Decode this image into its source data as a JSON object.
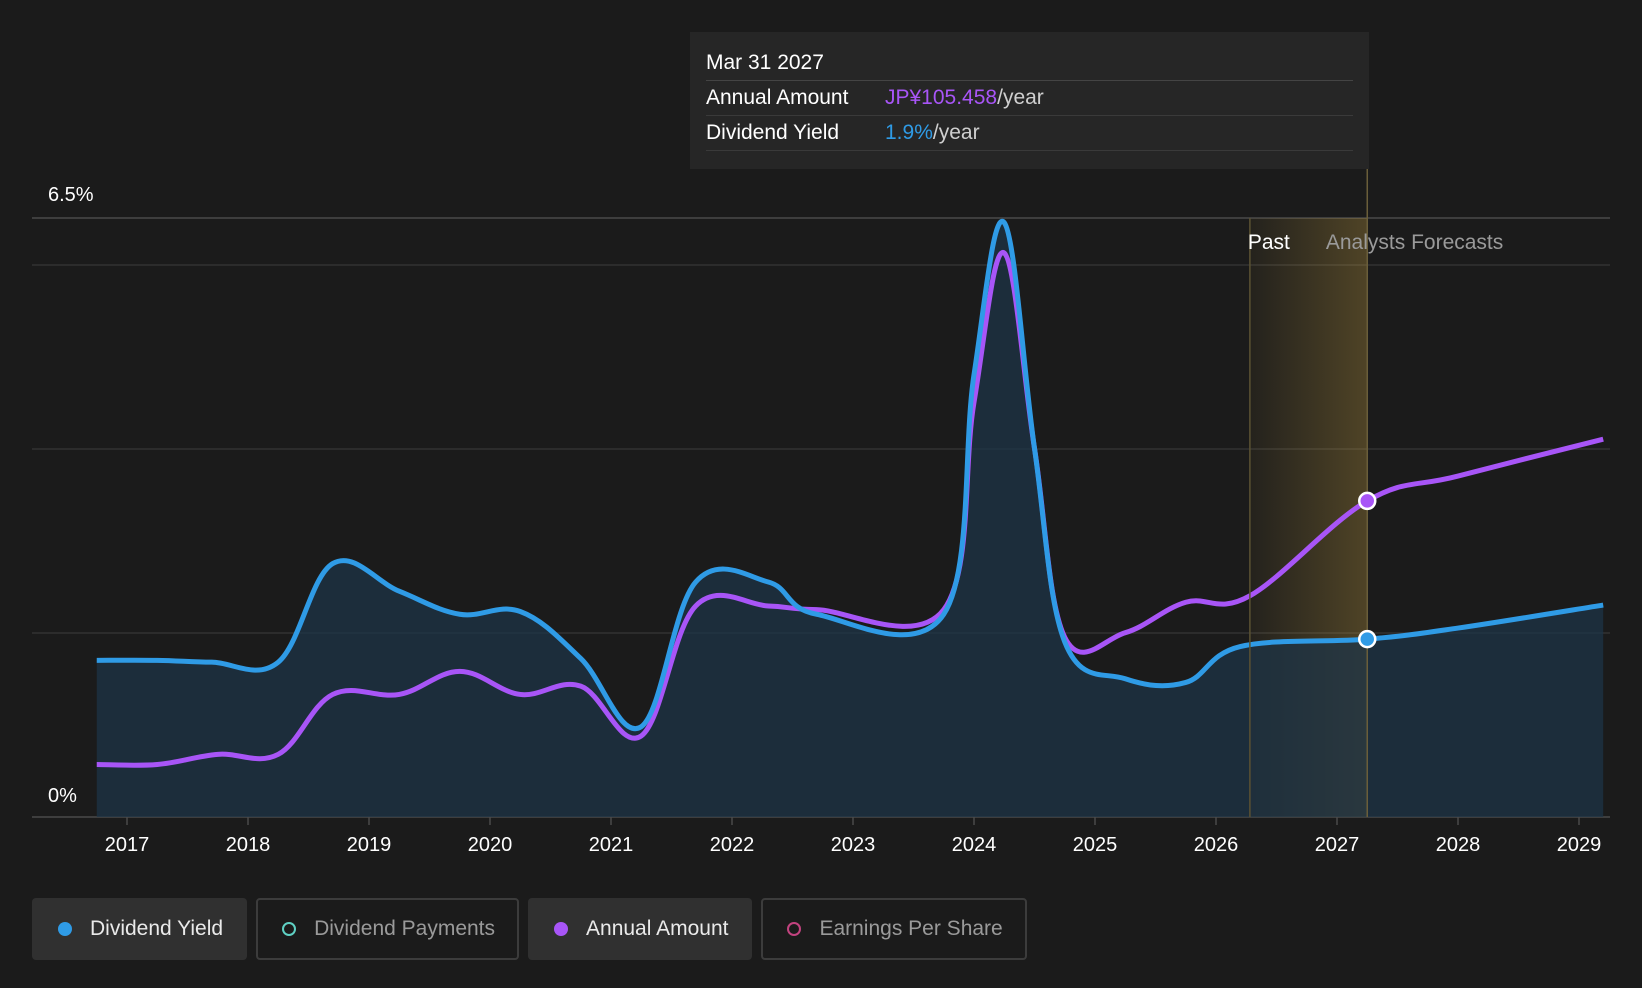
{
  "chart_data": {
    "type": "area",
    "y_axis": {
      "labels": [
        "6.5%",
        "0%"
      ],
      "ylim": [
        0,
        6.5
      ],
      "unit": "%"
    },
    "x_axis": {
      "ticks": [
        "2017",
        "2018",
        "2019",
        "2020",
        "2021",
        "2022",
        "2023",
        "2024",
        "2025",
        "2026",
        "2027",
        "2028",
        "2029"
      ],
      "range": [
        2016.75,
        2029.2
      ]
    },
    "regions": {
      "past_label": "Past",
      "forecast_label": "Analysts Forecasts",
      "divider_x": 2026.28
    },
    "series": [
      {
        "name": "Dividend Yield",
        "color": "#2f9be6",
        "points": [
          [
            2016.75,
            1.7
          ],
          [
            2017.25,
            1.7
          ],
          [
            2017.7,
            1.68
          ],
          [
            2018.25,
            1.68
          ],
          [
            2018.7,
            2.75
          ],
          [
            2019.25,
            2.45
          ],
          [
            2019.75,
            2.2
          ],
          [
            2020.25,
            2.23
          ],
          [
            2020.75,
            1.72
          ],
          [
            2021.25,
            0.98
          ],
          [
            2021.7,
            2.55
          ],
          [
            2022.3,
            2.55
          ],
          [
            2022.7,
            2.2
          ],
          [
            2023.75,
            2.2
          ],
          [
            2024.0,
            4.8
          ],
          [
            2024.25,
            6.45
          ],
          [
            2024.5,
            4.0
          ],
          [
            2024.75,
            1.9
          ],
          [
            2025.25,
            1.5
          ],
          [
            2025.75,
            1.46
          ],
          [
            2026.2,
            1.85
          ],
          [
            2027.25,
            1.93
          ],
          [
            2028.0,
            2.05
          ],
          [
            2029.2,
            2.3
          ]
        ]
      },
      {
        "name": "Annual Amount",
        "color": "#a855f7",
        "points": [
          [
            2016.75,
            0.57
          ],
          [
            2017.25,
            0.57
          ],
          [
            2017.75,
            0.68
          ],
          [
            2018.25,
            0.68
          ],
          [
            2018.7,
            1.33
          ],
          [
            2019.25,
            1.33
          ],
          [
            2019.75,
            1.58
          ],
          [
            2020.25,
            1.33
          ],
          [
            2020.75,
            1.42
          ],
          [
            2021.25,
            0.88
          ],
          [
            2021.7,
            2.29
          ],
          [
            2022.3,
            2.29
          ],
          [
            2022.7,
            2.25
          ],
          [
            2023.75,
            2.25
          ],
          [
            2024.0,
            4.5
          ],
          [
            2024.25,
            6.12
          ],
          [
            2024.5,
            4.0
          ],
          [
            2024.75,
            1.95
          ],
          [
            2025.25,
            2.0
          ],
          [
            2025.75,
            2.33
          ],
          [
            2026.28,
            2.4
          ],
          [
            2027.25,
            3.43
          ],
          [
            2028.0,
            3.7
          ],
          [
            2029.2,
            4.1
          ]
        ]
      }
    ],
    "highlight": {
      "x": 2027.25,
      "yield": 1.93,
      "amount": 3.43
    }
  },
  "tooltip": {
    "date": "Mar 31 2027",
    "annual_label": "Annual Amount",
    "annual_value": "JP¥105.458",
    "annual_unit": "/year",
    "yield_label": "Dividend Yield",
    "yield_value": "1.9%",
    "yield_unit": "/year"
  },
  "legend": [
    {
      "label": "Dividend Yield",
      "active": true
    },
    {
      "label": "Dividend Payments",
      "active": false
    },
    {
      "label": "Annual Amount",
      "active": true
    },
    {
      "label": "Earnings Per Share",
      "active": false
    }
  ]
}
